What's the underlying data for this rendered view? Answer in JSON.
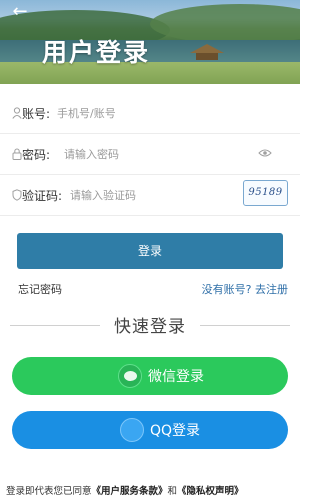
{
  "header": {
    "title": "用户登录",
    "back_icon": "arrow-left-icon"
  },
  "form": {
    "account": {
      "label": "账号:",
      "placeholder": "手机号/账号",
      "icon": "user-icon"
    },
    "password": {
      "label": "密码:",
      "placeholder": "请输入密码",
      "icon": "lock-icon",
      "toggle_icon": "eye-icon"
    },
    "captcha": {
      "label": "验证码:",
      "placeholder": "请输入验证码",
      "icon": "shield-icon",
      "code": "95189"
    }
  },
  "actions": {
    "login_label": "登录",
    "forgot_label": "忘记密码",
    "register_label": "没有账号? 去注册"
  },
  "quick_login": {
    "title": "快速登录",
    "wechat_label": "微信登录",
    "qq_label": "QQ登录"
  },
  "agreement": {
    "prefix": "登录即代表您已同意",
    "terms": "《用户服务条款》",
    "conjunction": "和",
    "privacy": "《隐私权声明》"
  },
  "colors": {
    "primary_button": "#2f7da7",
    "wechat": "#2bc95c",
    "qq": "#1a8fe3",
    "link": "#2f6fa8"
  }
}
